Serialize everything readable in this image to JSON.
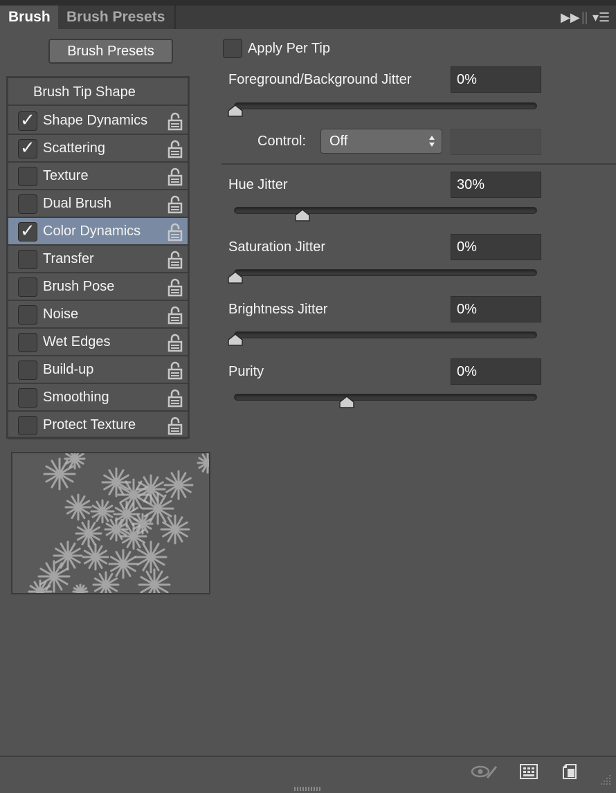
{
  "tabs": {
    "brush": "Brush",
    "presets": "Brush Presets"
  },
  "header_buttons": {
    "expand": "▶▶",
    "separator": "||",
    "menu": "▾☰"
  },
  "presets_button": "Brush Presets",
  "list": {
    "title": "Brush Tip Shape",
    "items": [
      {
        "label": "Shape Dynamics",
        "checked": true,
        "selected": false
      },
      {
        "label": "Scattering",
        "checked": true,
        "selected": false
      },
      {
        "label": "Texture",
        "checked": false,
        "selected": false
      },
      {
        "label": "Dual Brush",
        "checked": false,
        "selected": false
      },
      {
        "label": "Color Dynamics",
        "checked": true,
        "selected": true
      },
      {
        "label": "Transfer",
        "checked": false,
        "selected": false
      },
      {
        "label": "Brush Pose",
        "checked": false,
        "selected": false
      },
      {
        "label": "Noise",
        "checked": false,
        "selected": false
      },
      {
        "label": "Wet Edges",
        "checked": false,
        "selected": false
      },
      {
        "label": "Build-up",
        "checked": false,
        "selected": false
      },
      {
        "label": "Smoothing",
        "checked": false,
        "selected": false
      },
      {
        "label": "Protect Texture",
        "checked": false,
        "selected": false
      }
    ]
  },
  "apply_per_tip": {
    "label": "Apply Per Tip",
    "checked": false
  },
  "fg_bg_jitter": {
    "label": "Foreground/Background Jitter",
    "value": "0%",
    "slider": 0
  },
  "control": {
    "label": "Control:",
    "value": "Off"
  },
  "hue_jitter": {
    "label": "Hue Jitter",
    "value": "30%",
    "slider": 30
  },
  "saturation_jitter": {
    "label": "Saturation Jitter",
    "value": "0%",
    "slider": 0
  },
  "brightness_jitter": {
    "label": "Brightness Jitter",
    "value": "0%",
    "slider": 0
  },
  "purity": {
    "label": "Purity",
    "value": "0%",
    "slider": 50
  },
  "icons": {
    "lock": "lock-open-icon",
    "visibility": "eye-brush-icon",
    "grid": "grid-icon",
    "new_preset": "new-preset-icon"
  },
  "colors": {
    "panel": "#535353",
    "selection": "#7a8aa2",
    "field": "#3b3b3b"
  }
}
